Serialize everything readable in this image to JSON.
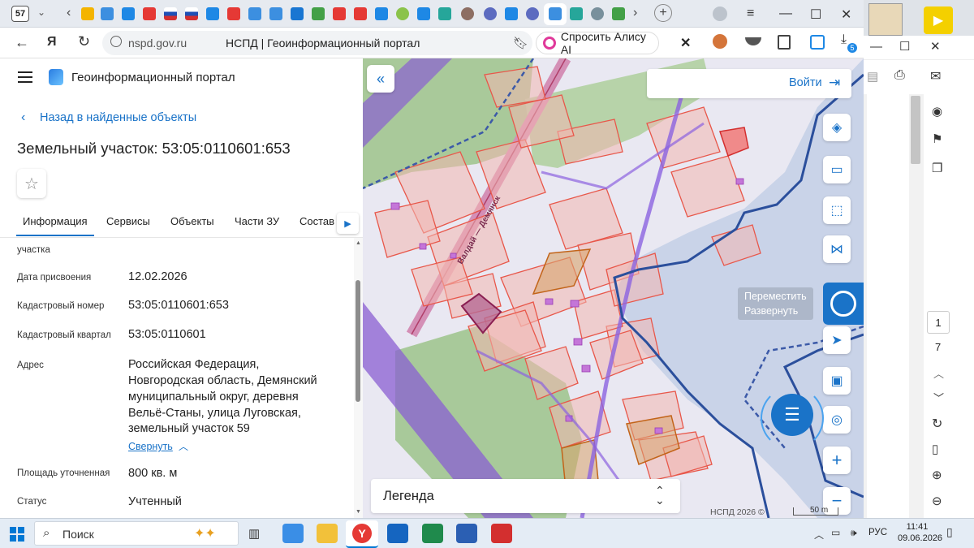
{
  "browser": {
    "tab_count": "57",
    "url": "nspd.gov.ru",
    "page_title": "НСПД | Геоинформационный портал",
    "alice_label": "Спросить Алису AI",
    "download_badge": "5"
  },
  "portal": {
    "title": "Геоинформационный портал",
    "back_link": "Назад в найденные объекты",
    "heading": "Земельный участок: 53:05:0110601:653",
    "tabs": [
      "Информация",
      "Сервисы",
      "Объекты",
      "Части ЗУ",
      "Состав"
    ],
    "clipped_label": "участка",
    "rows": [
      {
        "label": "Дата присвоения",
        "value": "12.02.2026"
      },
      {
        "label": "Кадастровый номер",
        "value": "53:05:0110601:653"
      },
      {
        "label": "Кадастровый квартал",
        "value": "53:05:0110601"
      }
    ],
    "address_label": "Адрес",
    "address_lines": [
      "Российская Федерация,",
      "Новгородская область, Демянский",
      "муниципальный округ, деревня",
      "Вельё-Станы, улица Луговская,",
      "земельный участок 59"
    ],
    "collapse_link": "Свернуть",
    "area_label": "Площадь уточненная",
    "area_value": "800 кв. м",
    "status_label": "Статус",
    "status_value": "Учтенный"
  },
  "map": {
    "login_label": "Войти",
    "road_label": "Валдай — Демянск",
    "tooltip_move": "Переместить",
    "tooltip_expand": "Развернуть",
    "legend_label": "Легенда",
    "copyright": "НСПД 2026 ©",
    "scale": "50 m"
  },
  "pdf": {
    "page_current": "1",
    "page_total": "7"
  },
  "taskbar": {
    "search_placeholder": "Поиск",
    "lang": "РУС",
    "time": "11:41",
    "date": "09.06.2026"
  },
  "colors": {
    "accent": "#1a73c8",
    "parcel": "#e8574a",
    "water": "#c9d3e8"
  }
}
